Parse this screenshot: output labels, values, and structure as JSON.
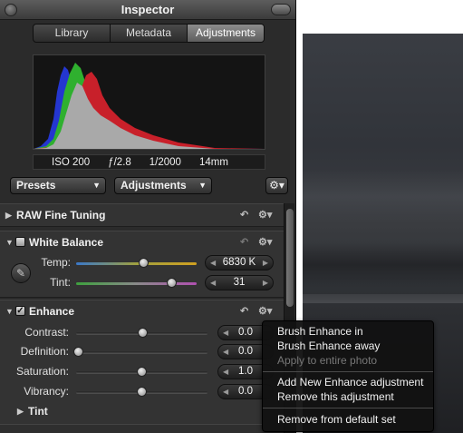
{
  "window": {
    "title": "Inspector"
  },
  "tabs": [
    {
      "label": "Library",
      "active": false
    },
    {
      "label": "Metadata",
      "active": false
    },
    {
      "label": "Adjustments",
      "active": true
    }
  ],
  "exif": {
    "iso": "ISO 200",
    "aperture": "ƒ/2.8",
    "shutter": "1/2000",
    "focal": "14mm"
  },
  "toolbar": {
    "presets_label": "Presets",
    "adjustments_label": "Adjustments"
  },
  "sections": {
    "raw": {
      "title": "RAW Fine Tuning"
    },
    "white_balance": {
      "title": "White Balance",
      "temp_label": "Temp:",
      "temp_value": "6830 K",
      "tint_label": "Tint:",
      "tint_value": "31"
    },
    "enhance": {
      "title": "Enhance",
      "checked": true,
      "sliders": [
        {
          "label": "Contrast:",
          "value": "0.0"
        },
        {
          "label": "Definition:",
          "value": "0.0"
        },
        {
          "label": "Saturation:",
          "value": "1.0"
        },
        {
          "label": "Vibrancy:",
          "value": "0.0"
        }
      ],
      "tint_title": "Tint"
    }
  },
  "context_menu": {
    "brush_in": "Brush Enhance in",
    "brush_away": "Brush Enhance away",
    "apply_entire": "Apply to entire photo",
    "add_new": "Add New Enhance adjustment",
    "remove_this": "Remove this adjustment",
    "remove_default": "Remove from default set"
  },
  "colors": {
    "panel_bg": "#2b2b2b",
    "histogram_red": "#c8202a",
    "histogram_green": "#2fb02f",
    "histogram_blue": "#2436d0"
  }
}
